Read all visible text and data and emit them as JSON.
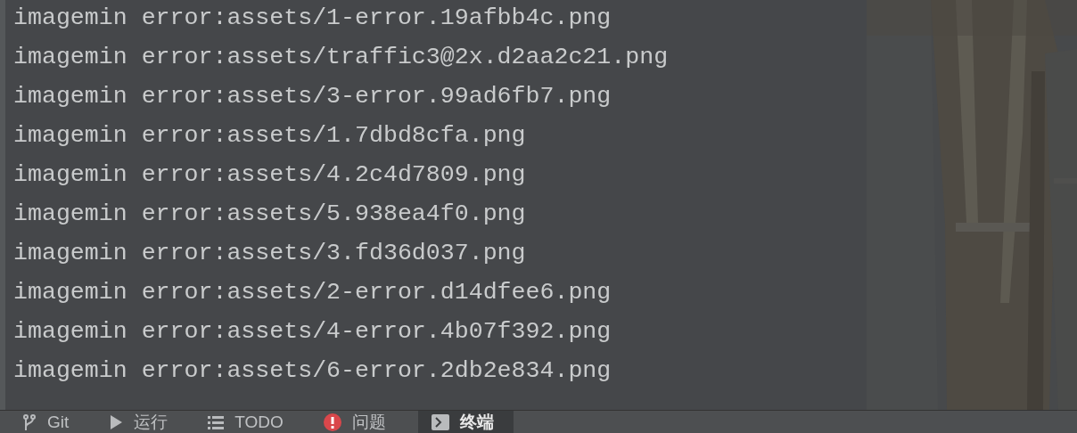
{
  "terminal": {
    "lines": [
      "imagemin error:assets/1-error.19afbb4c.png",
      "imagemin error:assets/traffic3@2x.d2aa2c21.png",
      "imagemin error:assets/3-error.99ad6fb7.png",
      "imagemin error:assets/1.7dbd8cfa.png",
      "imagemin error:assets/4.2c4d7809.png",
      "imagemin error:assets/5.938ea4f0.png",
      "imagemin error:assets/3.fd36d037.png",
      "imagemin error:assets/2-error.d14dfee6.png",
      "imagemin error:assets/4-error.4b07f392.png",
      "imagemin error:assets/6-error.2db2e834.png"
    ]
  },
  "tool_tabs": [
    {
      "label": "Git",
      "kind": "git",
      "selected": false
    },
    {
      "label": "运行",
      "kind": "run",
      "selected": false
    },
    {
      "label": "TODO",
      "kind": "todo",
      "selected": false
    },
    {
      "label": "问题",
      "kind": "problems",
      "selected": false
    },
    {
      "label": "终端",
      "kind": "terminal",
      "selected": true
    }
  ]
}
